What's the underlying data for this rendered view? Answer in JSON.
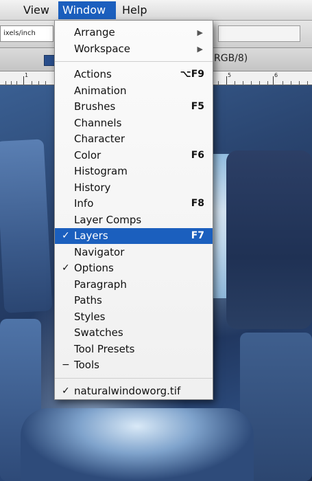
{
  "menubar": {
    "items": [
      "View",
      "Window",
      "Help"
    ]
  },
  "options_bar": {
    "resolution_units": "ixels/inch"
  },
  "document": {
    "mode_text": "RGB/8)"
  },
  "ruler": {
    "numbers": [
      "1",
      "5",
      "6"
    ]
  },
  "window_menu": {
    "items": [
      {
        "label": "Arrange",
        "submenu": true
      },
      {
        "label": "Workspace",
        "submenu": true
      },
      {
        "separator": true
      },
      {
        "label": "Actions",
        "shortcut": "⌥F9"
      },
      {
        "label": "Animation"
      },
      {
        "label": "Brushes",
        "shortcut": "F5"
      },
      {
        "label": "Channels"
      },
      {
        "label": "Character"
      },
      {
        "label": "Color",
        "shortcut": "F6"
      },
      {
        "label": "Histogram"
      },
      {
        "label": "History"
      },
      {
        "label": "Info",
        "shortcut": "F8"
      },
      {
        "label": "Layer Comps"
      },
      {
        "label": "Layers",
        "shortcut": "F7",
        "checked": true,
        "highlighted": true
      },
      {
        "label": "Navigator"
      },
      {
        "label": "Options",
        "checked": true
      },
      {
        "label": "Paragraph"
      },
      {
        "label": "Paths"
      },
      {
        "label": "Styles"
      },
      {
        "label": "Swatches"
      },
      {
        "label": "Tool Presets"
      },
      {
        "label": "Tools",
        "dash": true
      },
      {
        "separator": true
      },
      {
        "label": "naturalwindoworg.tif",
        "checked": true
      }
    ]
  },
  "colors": {
    "menu_highlight": "#1b5fbe",
    "menu_background": "#f6f6f6"
  }
}
